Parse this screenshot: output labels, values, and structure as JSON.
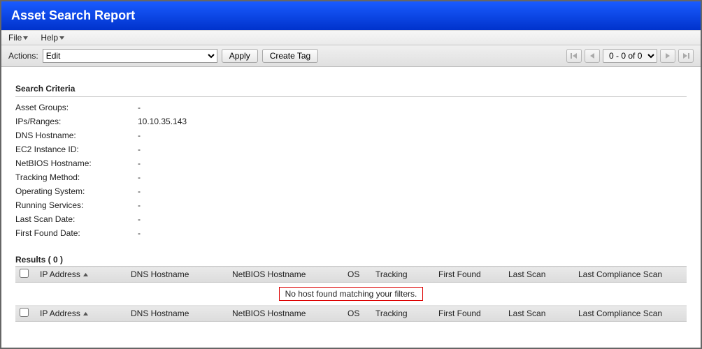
{
  "header": {
    "title": "Asset Search Report"
  },
  "menu": {
    "file": "File",
    "help": "Help"
  },
  "actionsBar": {
    "label": "Actions:",
    "selected": "Edit",
    "apply": "Apply",
    "createTag": "Create Tag"
  },
  "pager": {
    "range": "0 - 0 of 0"
  },
  "criteria": {
    "heading": "Search Criteria",
    "rows": [
      {
        "label": "Asset Groups:",
        "value": "-"
      },
      {
        "label": "IPs/Ranges:",
        "value": "10.10.35.143"
      },
      {
        "label": "DNS Hostname:",
        "value": "-"
      },
      {
        "label": "EC2 Instance ID:",
        "value": "-"
      },
      {
        "label": "NetBIOS Hostname:",
        "value": "-"
      },
      {
        "label": "Tracking Method:",
        "value": "-"
      },
      {
        "label": "Operating System:",
        "value": "-"
      },
      {
        "label": "Running Services:",
        "value": "-"
      },
      {
        "label": "Last Scan Date:",
        "value": "-"
      },
      {
        "label": "First Found Date:",
        "value": "-"
      }
    ]
  },
  "results": {
    "heading": "Results ( 0 )",
    "columns": {
      "ip": "IP Address",
      "dns": "DNS Hostname",
      "netbios": "NetBIOS Hostname",
      "os": "OS",
      "tracking": "Tracking",
      "firstFound": "First Found",
      "lastScan": "Last Scan",
      "lastCompliance": "Last Compliance Scan"
    },
    "emptyMessage": "No host found matching your filters."
  }
}
